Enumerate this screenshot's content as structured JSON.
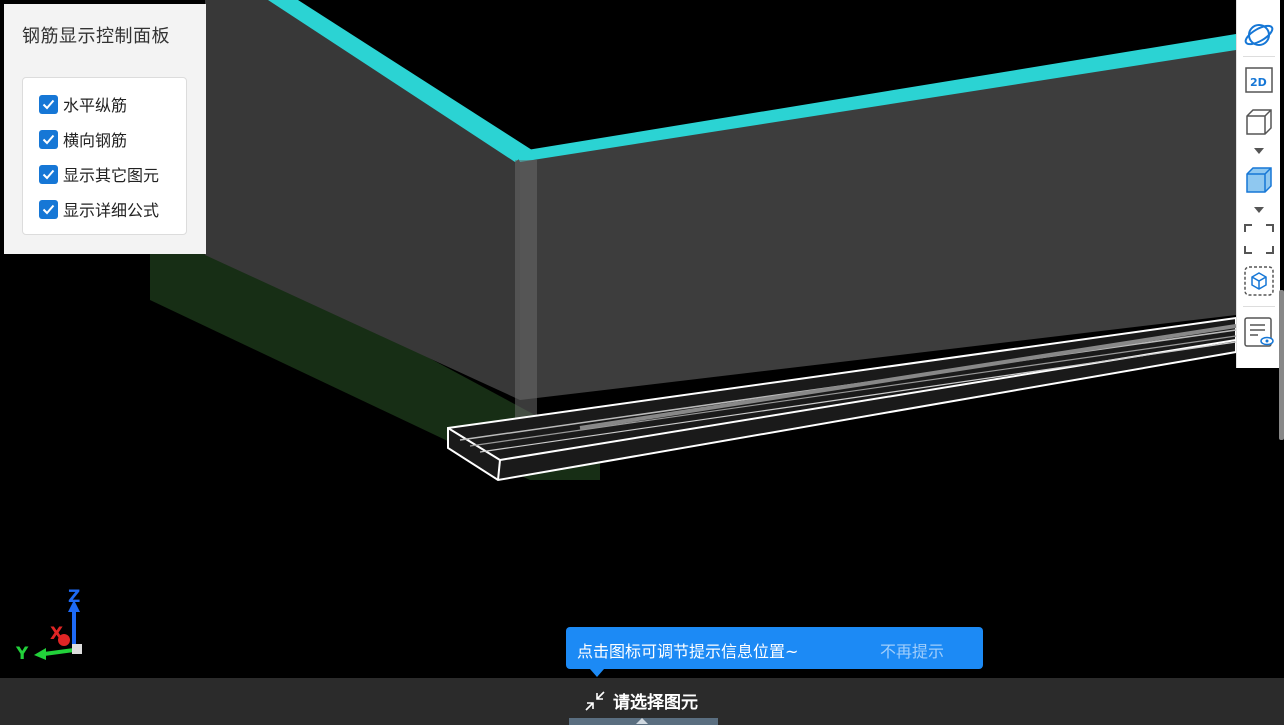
{
  "panel": {
    "title": "钢筋显示控制面板",
    "options": [
      {
        "label": "水平纵筋",
        "checked": true
      },
      {
        "label": "横向钢筋",
        "checked": true
      },
      {
        "label": "显示其它图元",
        "checked": true
      },
      {
        "label": "显示详细公式",
        "checked": true
      }
    ]
  },
  "toolbar": {
    "items": [
      "orbit-icon",
      "2d-view-icon",
      "wireframe-cube-icon",
      "solid-cube-icon",
      "fullscreen-icon",
      "select-box-icon",
      "show-list-icon"
    ],
    "view_2d_label": "2D"
  },
  "axis": {
    "x": "X",
    "y": "Y",
    "z": "Z"
  },
  "tooltip": {
    "text": "点击图标可调节提示信息位置~",
    "dismiss": "不再提示"
  },
  "status": {
    "text": "请选择图元"
  },
  "colors": {
    "accent": "#1677d6",
    "tooltip": "#1c8af5",
    "wall_top": "#2bd3d3",
    "wall_face": "#3d3d3d"
  }
}
